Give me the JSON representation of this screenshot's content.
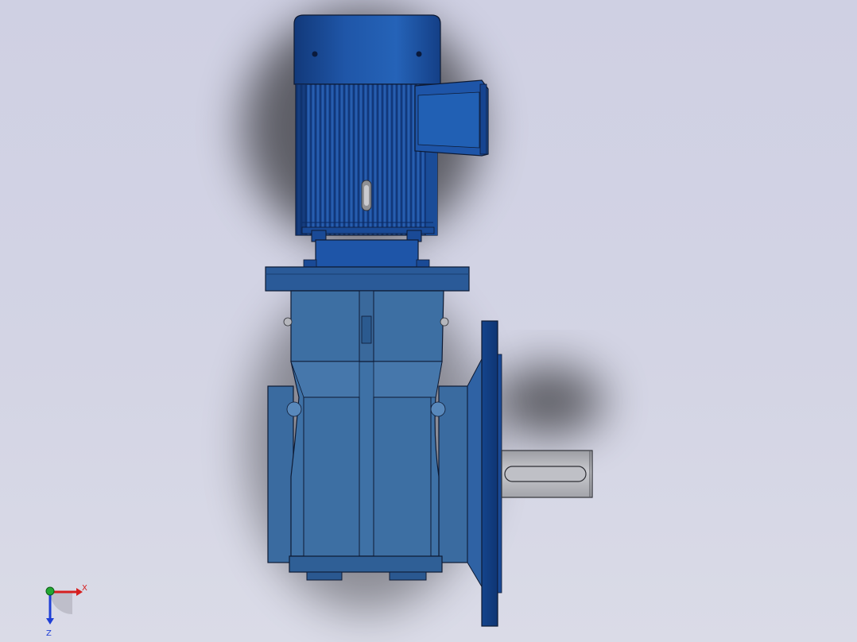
{
  "colors": {
    "background_top": "#cfd0e3",
    "background_bottom": "#dadbe7",
    "body_blue": "#3d6fa3",
    "body_blue_dark": "#2a5590",
    "motor_blue": "#1f56a8",
    "motor_blue_dark": "#123c80",
    "shaft_gray": "#b8b9bf",
    "outline": "#0e1a33",
    "axis_x": "#d61f1f",
    "axis_y": "#22a832",
    "axis_z": "#1f3fd6"
  },
  "triad": {
    "x_label": "X",
    "z_label": "Z"
  }
}
